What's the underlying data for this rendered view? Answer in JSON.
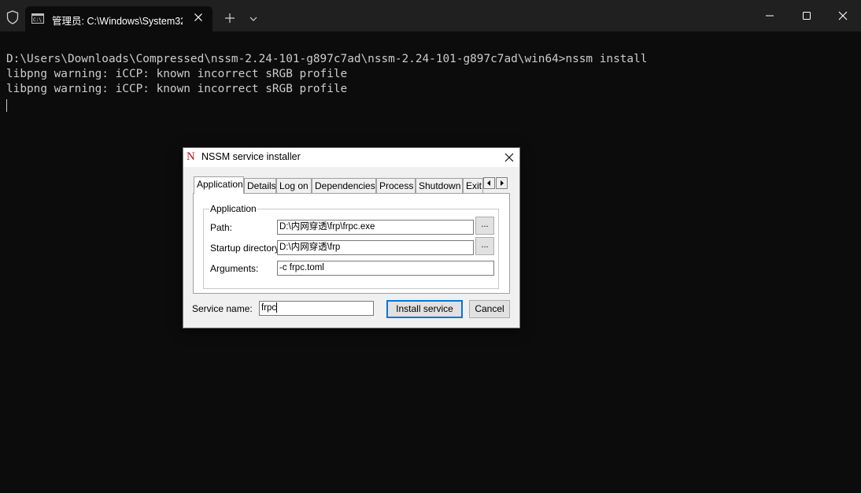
{
  "window": {
    "tab_title": "管理员: C:\\Windows\\System32"
  },
  "terminal": {
    "lines": [
      "D:\\Users\\Downloads\\Compressed\\nssm-2.24-101-g897c7ad\\nssm-2.24-101-g897c7ad\\win64>nssm install",
      "libpng warning: iCCP: known incorrect sRGB profile",
      "libpng warning: iCCP: known incorrect sRGB profile"
    ]
  },
  "dialog": {
    "logo": "N",
    "title": "NSSM service installer",
    "tabs": [
      "Application",
      "Details",
      "Log on",
      "Dependencies",
      "Process",
      "Shutdown",
      "Exit"
    ],
    "group_title": "Application",
    "path_label": "Path:",
    "path_value": "D:\\内网穿透\\frp\\frpc.exe",
    "startup_label": "Startup directory:",
    "startup_value": "D:\\内网穿透\\frp",
    "arguments_label": "Arguments:",
    "arguments_value": "-c frpc.toml",
    "browse_label": "...",
    "service_name_label": "Service name:",
    "service_name_value": "frpc",
    "install_label": "Install service",
    "cancel_label": "Cancel"
  },
  "colors": {
    "terminal_bg": "#0c0c0c",
    "titlebar_bg": "#202020",
    "dialog_bg": "#f0f0f0",
    "accent": "#0078d7"
  }
}
